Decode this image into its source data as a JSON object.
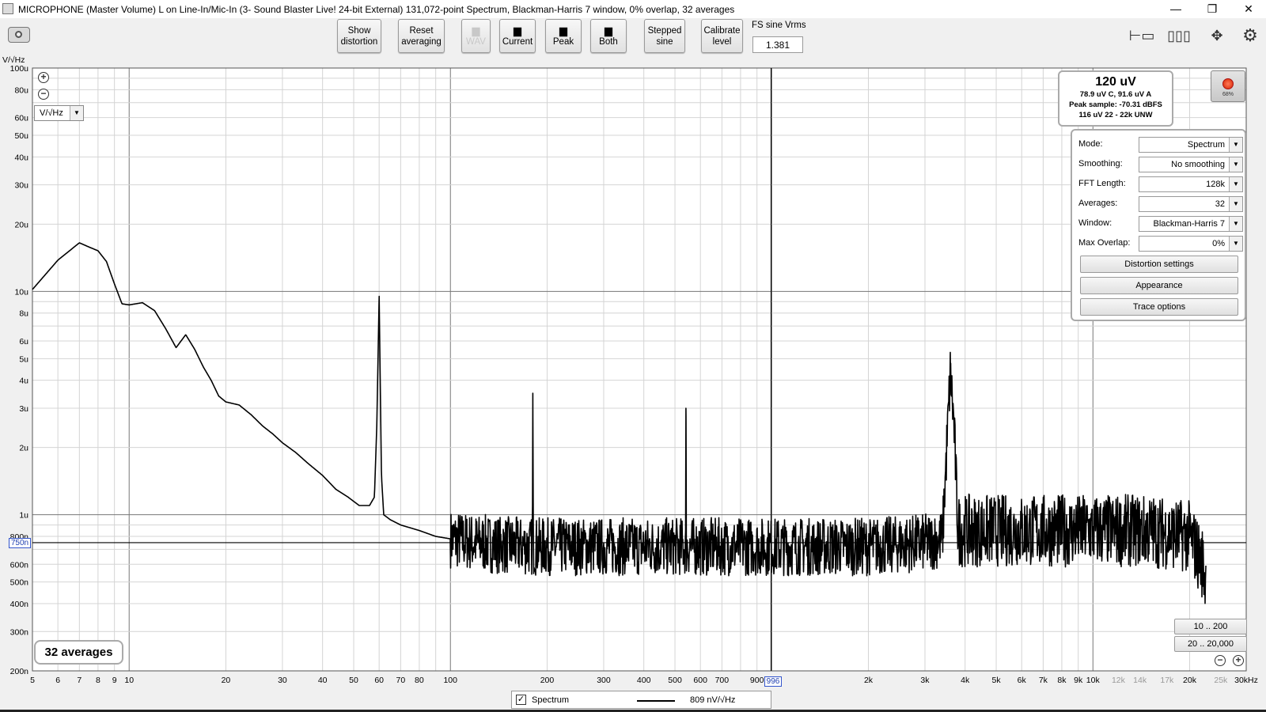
{
  "window": {
    "title": "MICROPHONE (Master Volume) L on Line-In/Mic-In (3- Sound Blaster Live! 24-bit External) 131,072-point Spectrum, Blackman-Harris 7 window, 0% overlap, 32 averages",
    "minimize": "—",
    "restore": "❐",
    "close": "✕"
  },
  "toolbar": {
    "show_distortion": [
      "Show",
      "distortion"
    ],
    "reset_averaging": [
      "Reset",
      "averaging"
    ],
    "wav": "WAV",
    "current": "Current",
    "peak": "Peak",
    "both": "Both",
    "stepped_sine": [
      "Stepped",
      "sine"
    ],
    "calibrate_level": [
      "Calibrate",
      "level"
    ],
    "fs_sine_label": "FS sine Vrms",
    "fs_sine_value": "1.381"
  },
  "plot": {
    "y_unit_label": "V/√Hz",
    "unit_select": "V/√Hz",
    "y_ticks": [
      {
        "v": 0.0001,
        "label": "100u",
        "major": true
      },
      {
        "v": 8e-05,
        "label": "80u"
      },
      {
        "v": 6e-05,
        "label": "60u"
      },
      {
        "v": 5e-05,
        "label": "50u"
      },
      {
        "v": 4e-05,
        "label": "40u"
      },
      {
        "v": 3e-05,
        "label": "30u"
      },
      {
        "v": 2e-05,
        "label": "20u"
      },
      {
        "v": 1e-05,
        "label": "10u",
        "major": true
      },
      {
        "v": 8e-06,
        "label": "8u"
      },
      {
        "v": 6e-06,
        "label": "6u"
      },
      {
        "v": 5e-06,
        "label": "5u"
      },
      {
        "v": 4e-06,
        "label": "4u"
      },
      {
        "v": 3e-06,
        "label": "3u"
      },
      {
        "v": 2e-06,
        "label": "2u"
      },
      {
        "v": 1e-06,
        "label": "1u",
        "major": true
      },
      {
        "v": 8e-07,
        "label": "800n"
      },
      {
        "v": 6e-07,
        "label": "600n"
      },
      {
        "v": 5e-07,
        "label": "500n"
      },
      {
        "v": 4e-07,
        "label": "400n"
      },
      {
        "v": 3e-07,
        "label": "300n"
      },
      {
        "v": 2e-07,
        "label": "200n"
      }
    ],
    "x_ticks": [
      {
        "f": 5,
        "label": "5"
      },
      {
        "f": 6,
        "label": "6"
      },
      {
        "f": 7,
        "label": "7"
      },
      {
        "f": 8,
        "label": "8"
      },
      {
        "f": 9,
        "label": "9"
      },
      {
        "f": 10,
        "label": "10",
        "major": true
      },
      {
        "f": 20,
        "label": "20"
      },
      {
        "f": 30,
        "label": "30"
      },
      {
        "f": 40,
        "label": "40"
      },
      {
        "f": 50,
        "label": "50"
      },
      {
        "f": 60,
        "label": "60"
      },
      {
        "f": 70,
        "label": "70"
      },
      {
        "f": 80,
        "label": "80"
      },
      {
        "f": 100,
        "label": "100",
        "major": true
      },
      {
        "f": 200,
        "label": "200"
      },
      {
        "f": 300,
        "label": "300"
      },
      {
        "f": 400,
        "label": "400"
      },
      {
        "f": 500,
        "label": "500"
      },
      {
        "f": 600,
        "label": "600"
      },
      {
        "f": 700,
        "label": "700"
      },
      {
        "f": 900,
        "label": "900"
      },
      {
        "f": 1000,
        "label": "1k",
        "major": true
      },
      {
        "f": 2000,
        "label": "2k"
      },
      {
        "f": 3000,
        "label": "3k"
      },
      {
        "f": 4000,
        "label": "4k"
      },
      {
        "f": 5000,
        "label": "5k"
      },
      {
        "f": 6000,
        "label": "6k"
      },
      {
        "f": 7000,
        "label": "7k"
      },
      {
        "f": 8000,
        "label": "8k"
      },
      {
        "f": 9000,
        "label": "9k"
      },
      {
        "f": 10000,
        "label": "10k",
        "major": true
      },
      {
        "f": 12000,
        "label": "12k",
        "minor_label": true
      },
      {
        "f": 14000,
        "label": "14k",
        "minor_label": true
      },
      {
        "f": 17000,
        "label": "17k",
        "minor_label": true
      },
      {
        "f": 20000,
        "label": "20k"
      },
      {
        "f": 25000,
        "label": "25k",
        "minor_label": true
      },
      {
        "f": 30000,
        "label": "30kHz"
      }
    ],
    "cursor_x_label": "996",
    "cursor_y_label": "750n",
    "averages_box": "32 averages"
  },
  "level_box": {
    "main": "120 uV",
    "line1": "78.9 uV C, 91.6 uV A",
    "line2": "Peak sample: -70.31 dBFS",
    "line3": "116 uV 22 - 22k UNW"
  },
  "record": {
    "percent": "68%"
  },
  "settings": {
    "rows": [
      {
        "label": "Mode:",
        "value": "Spectrum"
      },
      {
        "label": "Smoothing:",
        "value": "No  smoothing"
      },
      {
        "label": "FFT Length:",
        "value": "128k"
      },
      {
        "label": "Averages:",
        "value": "32"
      },
      {
        "label": "Window:",
        "value": "Blackman-Harris 7"
      },
      {
        "label": "Max Overlap:",
        "value": "0%"
      }
    ],
    "buttons": [
      "Distortion settings",
      "Appearance",
      "Trace options"
    ]
  },
  "range_buttons": [
    "10 .. 200",
    "20 .. 20,000"
  ],
  "legend": {
    "checked": "✓",
    "name": "Spectrum",
    "value": "809 nV/√Hz"
  },
  "chart_data": {
    "type": "line",
    "title": "",
    "xlabel": "",
    "ylabel": "V/√Hz",
    "x_scale": "log",
    "y_scale": "log",
    "xlim": [
      5,
      30000
    ],
    "ylim": [
      2e-07,
      0.0001
    ],
    "grid": true,
    "series": [
      {
        "name": "Spectrum",
        "color": "#000000",
        "x": [
          5,
          6,
          7,
          7.5,
          8,
          8.5,
          9,
          9.5,
          10,
          11,
          12,
          13,
          14,
          15,
          16,
          17,
          18,
          19,
          20,
          22,
          24,
          26,
          28,
          30,
          33,
          36,
          40,
          44,
          48,
          52,
          56,
          58,
          59,
          60,
          61,
          62,
          65,
          70,
          80,
          90,
          100,
          120,
          150,
          180,
          180.5,
          181,
          200,
          250,
          300,
          400,
          540,
          541,
          542,
          600,
          800,
          1000,
          1500,
          2000,
          3000,
          3400,
          3600,
          3700,
          3800,
          4000,
          6000,
          10000,
          15000,
          20000,
          22000,
          22500
        ],
        "y": [
          1.02e-05,
          1.38e-05,
          1.65e-05,
          1.58e-05,
          1.52e-05,
          1.36e-05,
          1.08e-05,
          8.8e-06,
          8.7e-06,
          8.9e-06,
          8.2e-06,
          6.8e-06,
          5.6e-06,
          6.4e-06,
          5.5e-06,
          4.6e-06,
          4e-06,
          3.4e-06,
          3.2e-06,
          3.1e-06,
          2.8e-06,
          2.5e-06,
          2.3e-06,
          2.1e-06,
          1.9e-06,
          1.7e-06,
          1.5e-06,
          1.3e-06,
          1.2e-06,
          1.1e-06,
          1.1e-06,
          1.2e-06,
          2.5e-06,
          9.5e-06,
          1.5e-06,
          1e-06,
          9.5e-07,
          9e-07,
          8.5e-07,
          8e-07,
          7.8e-07,
          7.5e-07,
          7.3e-07,
          7.2e-07,
          3.5e-06,
          7.2e-07,
          7.2e-07,
          7.2e-07,
          7.2e-07,
          7.2e-07,
          7.2e-07,
          3e-06,
          7.2e-07,
          7.2e-07,
          7.2e-07,
          7.2e-07,
          7.2e-07,
          7.2e-07,
          7.5e-07,
          7.8e-07,
          4.4e-06,
          2.4e-06,
          8.5e-07,
          8.5e-07,
          8.5e-07,
          8.5e-07,
          8.5e-07,
          8e-07,
          6e-07,
          5e-07
        ]
      }
    ],
    "noise_band": {
      "from": 100,
      "to": 22500,
      "ratio": 1.35
    }
  }
}
